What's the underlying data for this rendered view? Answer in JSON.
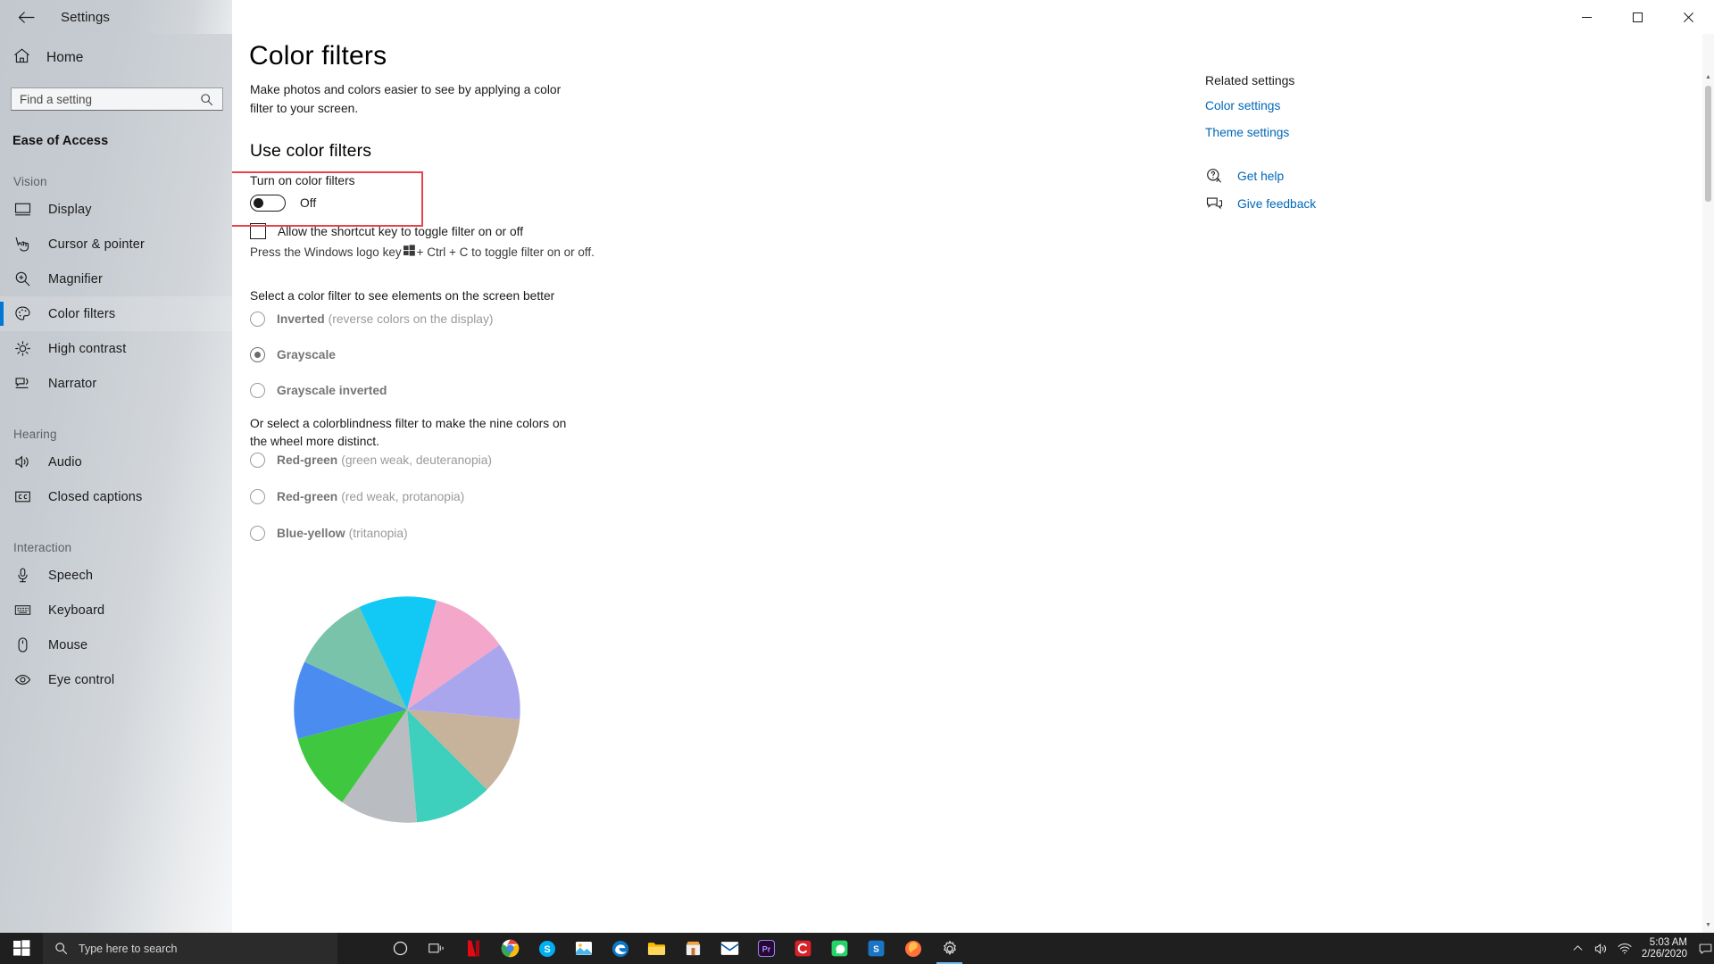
{
  "window": {
    "title": "Settings",
    "back_icon": "back-arrow-icon",
    "minimize_label": "—",
    "maximize_label": "□",
    "close_label": "✕"
  },
  "sidebar": {
    "home_label": "Home",
    "search_placeholder": "Find a setting",
    "search_value": "",
    "category_title": "Ease of Access",
    "groups": [
      {
        "label": "Vision",
        "items": [
          {
            "label": "Display",
            "icon": "monitor-icon",
            "selected": false
          },
          {
            "label": "Cursor & pointer",
            "icon": "cursor-pointer-icon",
            "selected": false
          },
          {
            "label": "Magnifier",
            "icon": "magnifier-icon",
            "selected": false
          },
          {
            "label": "Color filters",
            "icon": "palette-icon",
            "selected": true
          },
          {
            "label": "High contrast",
            "icon": "sun-icon",
            "selected": false
          },
          {
            "label": "Narrator",
            "icon": "narrator-icon",
            "selected": false
          }
        ]
      },
      {
        "label": "Hearing",
        "items": [
          {
            "label": "Audio",
            "icon": "speaker-icon",
            "selected": false
          },
          {
            "label": "Closed captions",
            "icon": "closed-captions-icon",
            "selected": false
          }
        ]
      },
      {
        "label": "Interaction",
        "items": [
          {
            "label": "Speech",
            "icon": "microphone-icon",
            "selected": false
          },
          {
            "label": "Keyboard",
            "icon": "keyboard-icon",
            "selected": false
          },
          {
            "label": "Mouse",
            "icon": "mouse-icon",
            "selected": false
          },
          {
            "label": "Eye control",
            "icon": "eye-icon",
            "selected": false
          }
        ]
      }
    ]
  },
  "main": {
    "page_title": "Color filters",
    "page_description": "Make photos and colors easier to see by applying a color filter to your screen.",
    "section_title": "Use color filters",
    "toggle": {
      "label": "Turn on color filters",
      "state": "Off",
      "checked": false,
      "highlight_color": "#e8434a"
    },
    "shortcut_checkbox": {
      "label": "Allow the shortcut key to toggle filter on or off",
      "checked": false
    },
    "shortcut_hint_before": "Press the Windows logo key ",
    "shortcut_hint_after": " + Ctrl + C to toggle filter on or off.",
    "filter_group_label": "Select a color filter to see elements on the screen better",
    "filter_options": [
      {
        "name": "Inverted",
        "extra": " (reverse colors on the display)",
        "checked": false
      },
      {
        "name": "Grayscale",
        "extra": "",
        "checked": true
      },
      {
        "name": "Grayscale inverted",
        "extra": "",
        "checked": false
      }
    ],
    "colorblind_group_label": "Or select a colorblindness filter to make the nine colors on the wheel more distinct.",
    "colorblind_options": [
      {
        "name": "Red-green",
        "extra": " (green weak, deuteranopia)",
        "checked": false
      },
      {
        "name": "Red-green",
        "extra": " (red weak, protanopia)",
        "checked": false
      },
      {
        "name": "Blue-yellow",
        "extra": " (tritanopia)",
        "checked": false
      }
    ],
    "color_wheel": {
      "name": "color-wheel",
      "segments": [
        {
          "color": "#f3a8cb"
        },
        {
          "color": "#aaa6ed"
        },
        {
          "color": "#c7b29c"
        },
        {
          "color": "#3ed0bd"
        },
        {
          "color": "#b9bcc0"
        },
        {
          "color": "#3fc83f"
        },
        {
          "color": "#4a8cf0"
        },
        {
          "color": "#79c3ab"
        },
        {
          "color": "#12c9f5"
        }
      ]
    }
  },
  "related": {
    "title": "Related settings",
    "links": [
      {
        "label": "Color settings"
      },
      {
        "label": "Theme settings"
      }
    ],
    "help": [
      {
        "label": "Get help",
        "icon": "help-icon"
      },
      {
        "label": "Give feedback",
        "icon": "feedback-icon"
      }
    ]
  },
  "taskbar": {
    "start_label": "start-button",
    "search_placeholder": "Type here to search",
    "cortana_label": "cortana-icon",
    "taskview_label": "task-view-icon",
    "apps": [
      {
        "name": "netflix-icon",
        "color": "#e50914"
      },
      {
        "name": "chrome-icon",
        "color": "#4285f4"
      },
      {
        "name": "skype-icon",
        "color": "#00aff0"
      },
      {
        "name": "photos-icon",
        "color": "#4db2ec"
      },
      {
        "name": "edge-icon",
        "color": "#0078d7"
      },
      {
        "name": "file-explorer-icon",
        "color": "#ffb900"
      },
      {
        "name": "microsoft-store-icon",
        "color": "#f2a33c"
      },
      {
        "name": "mail-icon",
        "color": "#0a5ca8"
      },
      {
        "name": "premiere-pro-icon",
        "color": "#9999ff"
      },
      {
        "name": "ccleaner-icon",
        "color": "#d8232a"
      },
      {
        "name": "whatsapp-icon",
        "color": "#25d366"
      },
      {
        "name": "snipping-tool-icon",
        "color": "#1a75c4"
      },
      {
        "name": "firefox-icon",
        "color": "#ff7139"
      },
      {
        "name": "settings-icon",
        "color": "#7a7a7a"
      }
    ],
    "tray": {
      "chevron": "show-hidden-icons",
      "volume": "volume-icon",
      "network": "network-icon",
      "time": "5:03 AM",
      "date": "2/26/2020",
      "action_center": "action-center-icon"
    }
  },
  "scrollbar": {
    "up_arrow": "▲",
    "down_arrow": "▼"
  }
}
